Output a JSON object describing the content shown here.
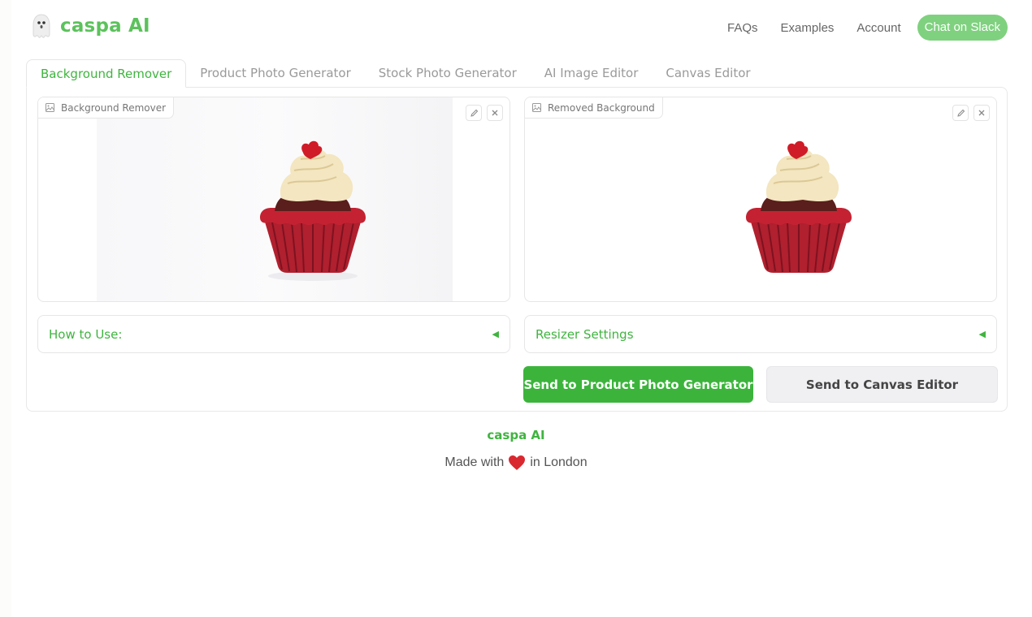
{
  "header": {
    "brand": "caspa AI",
    "nav": [
      "FAQs",
      "Examples",
      "Account"
    ],
    "cta_label": "Chat on Slack"
  },
  "tabs": [
    {
      "label": "Background Remover",
      "active": true
    },
    {
      "label": "Product Photo Generator",
      "active": false
    },
    {
      "label": "Stock Photo Generator",
      "active": false
    },
    {
      "label": "AI Image Editor",
      "active": false
    },
    {
      "label": "Canvas Editor",
      "active": false
    }
  ],
  "input_image": {
    "label": "Background Remover"
  },
  "output_image": {
    "label": "Removed Background"
  },
  "accordions": {
    "how_to_use": "How to Use:",
    "resizer": "Resizer Settings"
  },
  "buttons": {
    "send_product": "Send to Product Photo Generator",
    "send_canvas": "Send to Canvas Editor"
  },
  "footer": {
    "brand": "caspa AI",
    "made_prefix": "Made with",
    "made_suffix": "in London"
  },
  "colors": {
    "accent": "#3fb43f",
    "cta": "#7fd17f"
  },
  "icons": [
    "ghost-logo-icon",
    "image-icon",
    "pencil-icon",
    "close-icon",
    "triangle-left-icon",
    "heart-icon"
  ]
}
